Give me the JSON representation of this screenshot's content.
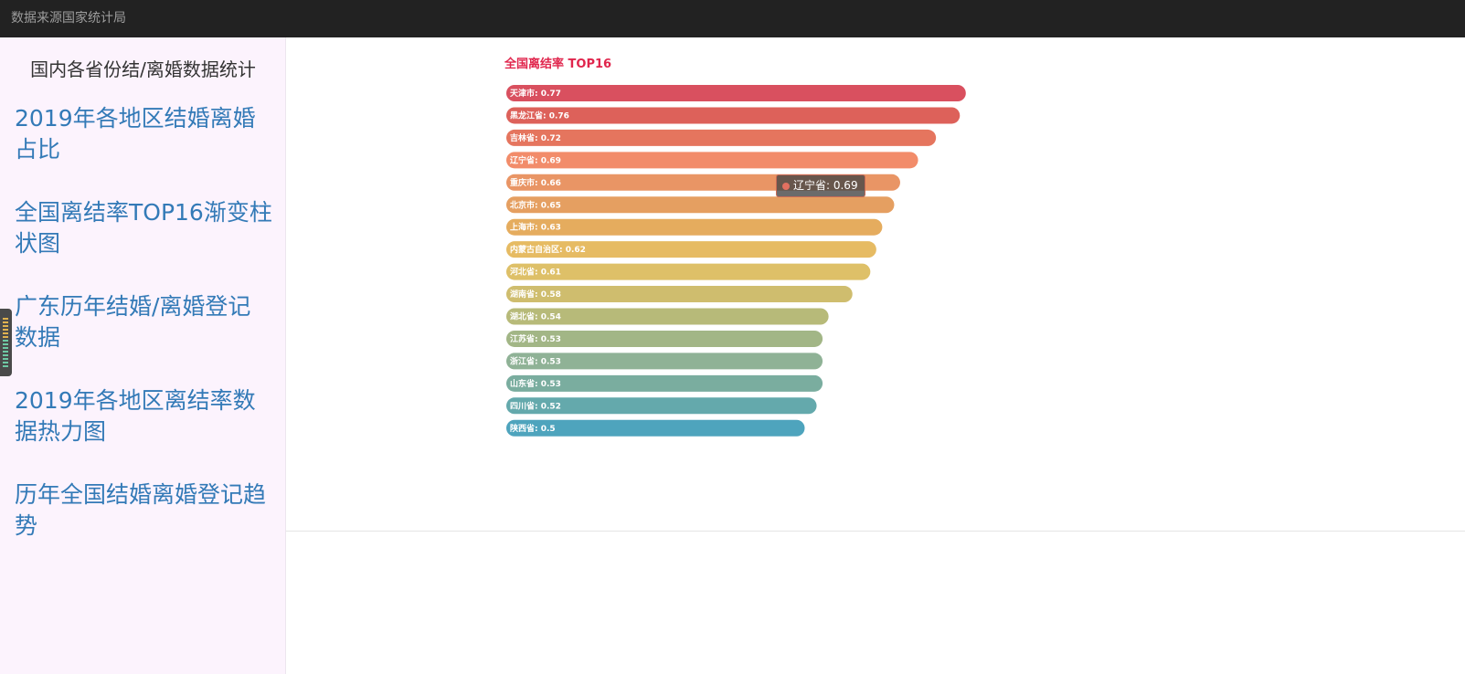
{
  "header": {
    "brand": "数据来源国家统计局"
  },
  "sidebar": {
    "title": "国内各省份结/离婚数据统计",
    "items": [
      {
        "label": "2019年各地区结婚离婚占比"
      },
      {
        "label": "全国离结率TOP16渐变柱状图"
      },
      {
        "label": "广东历年结婚/离婚登记数据"
      },
      {
        "label": "2019年各地区离结率数据热力图"
      },
      {
        "label": "历年全国结婚离婚登记趋势"
      }
    ]
  },
  "tooltip": {
    "text": "辽宁省: 0.69",
    "dot_color": "#e27060"
  },
  "colors": {
    "title": "#e0254c",
    "gradient": [
      "#d9505f",
      "#df6a58",
      "#f28c6a",
      "#e59963",
      "#e5ac5e",
      "#e6c265",
      "#cfbd6e",
      "#abb87e",
      "#8fb296",
      "#6faba3",
      "#4ea4bd"
    ]
  },
  "chart_data": {
    "type": "bar",
    "orientation": "horizontal",
    "title": "全国离结率 TOP16",
    "categories": [
      "天津市",
      "黑龙江省",
      "吉林省",
      "辽宁省",
      "重庆市",
      "北京市",
      "上海市",
      "内蒙古自治区",
      "河北省",
      "湖南省",
      "湖北省",
      "江苏省",
      "浙江省",
      "山东省",
      "四川省",
      "陕西省"
    ],
    "values": [
      0.77,
      0.76,
      0.72,
      0.69,
      0.66,
      0.65,
      0.63,
      0.62,
      0.61,
      0.58,
      0.54,
      0.53,
      0.53,
      0.53,
      0.52,
      0.5
    ],
    "labels": [
      "天津市: 0.77",
      "黑龙江省: 0.76",
      "吉林省: 0.72",
      "辽宁省: 0.69",
      "重庆市: 0.66",
      "北京市: 0.65",
      "上海市: 0.63",
      "内蒙古自治区: 0.62",
      "河北省: 0.61",
      "湖南省: 0.58",
      "湖北省: 0.54",
      "江苏省: 0.53",
      "浙江省: 0.53",
      "山东省: 0.53",
      "四川省: 0.52",
      "陕西省: 0.5"
    ],
    "xlim": [
      0,
      0.8
    ],
    "grid": false,
    "legend": "none"
  }
}
